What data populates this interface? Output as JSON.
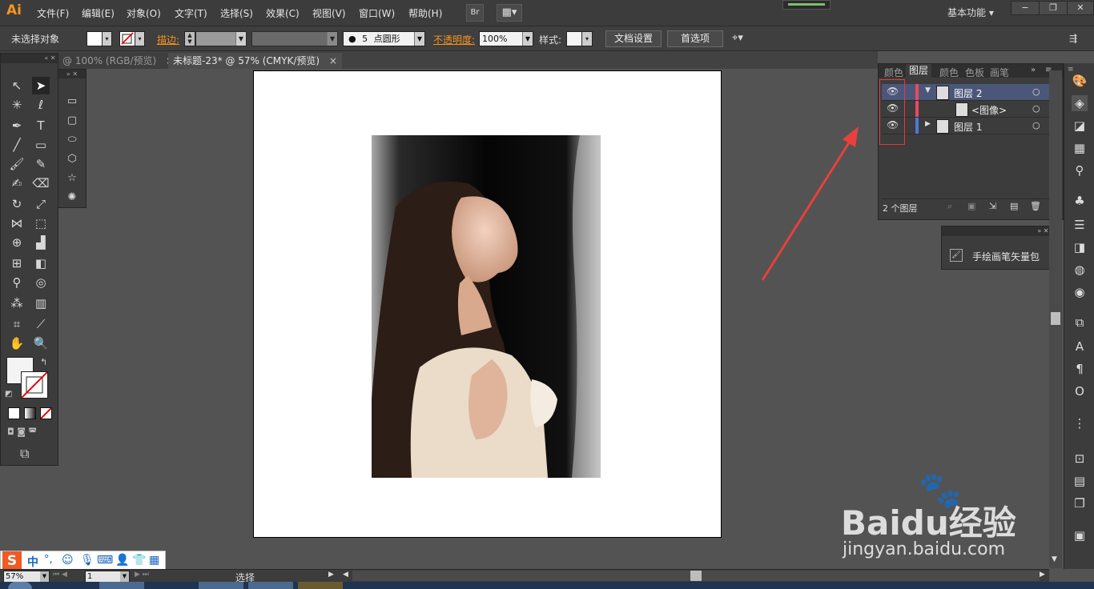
{
  "app": {
    "logo": "Ai"
  },
  "menu": [
    "文件(F)",
    "编辑(E)",
    "对象(O)",
    "文字(T)",
    "选择(S)",
    "效果(C)",
    "视图(V)",
    "窗口(W)",
    "帮助(H)"
  ],
  "menubar": {
    "bridge": "Br",
    "workspace": "基本功能"
  },
  "window_controls": {
    "minimize": "−",
    "restore": "❐",
    "close": "✕"
  },
  "control": {
    "selection": "未选择对象",
    "stroke_label": "描边:",
    "brush_size": "5",
    "brush_shape": "点圆形",
    "opacity_label": "不透明度:",
    "opacity_value": "100%",
    "style_label": "样式:",
    "doc_setup": "文档设置",
    "preferences": "首选项"
  },
  "tabs": [
    {
      "label": "@ 100% (RGB/预览)",
      "close": "×"
    },
    {
      "label": "未标题-23* @ 57% (CMYK/预览)",
      "close": "×"
    }
  ],
  "layers_panel": {
    "tabs": [
      "颜色",
      "图层",
      "颜色",
      "色板",
      "画笔"
    ],
    "active_tab": "图层",
    "rows": [
      {
        "name": "图层 2",
        "expanded": true,
        "color": "#e84a5f"
      },
      {
        "name": "<图像>",
        "color": "#e84a5f"
      },
      {
        "name": "图层 1",
        "expanded": false,
        "color": "#4a7bd8"
      }
    ],
    "footer": "2 个图层"
  },
  "brush_panel": {
    "item": "手绘画笔矢量包"
  },
  "status": {
    "zoom": "57%",
    "page": "1",
    "mode": "选择"
  },
  "ime": {
    "lang": "中"
  },
  "watermark": {
    "brand": "Baidu经验",
    "url": "jingyan.baidu.com"
  }
}
